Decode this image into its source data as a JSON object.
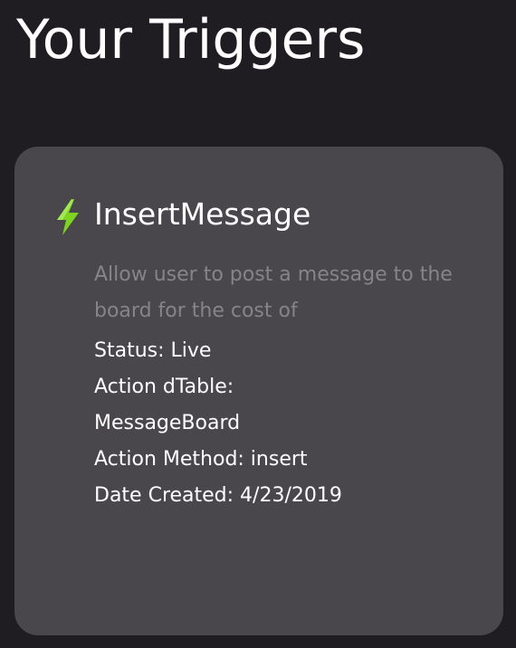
{
  "header": {
    "title": "Your Triggers"
  },
  "triggers": [
    {
      "icon": "lightning-bolt-icon",
      "icon_color": "#7ed321",
      "name": "InsertMessage",
      "description": "Allow user to post a message to the board for the cost of",
      "status": "Status: Live",
      "action_dtable_label": "Action dTable:",
      "action_dtable_value": "MessageBoard",
      "action_method": "Action Method: insert",
      "date_created": "Date Created: 4/23/2019"
    }
  ]
}
